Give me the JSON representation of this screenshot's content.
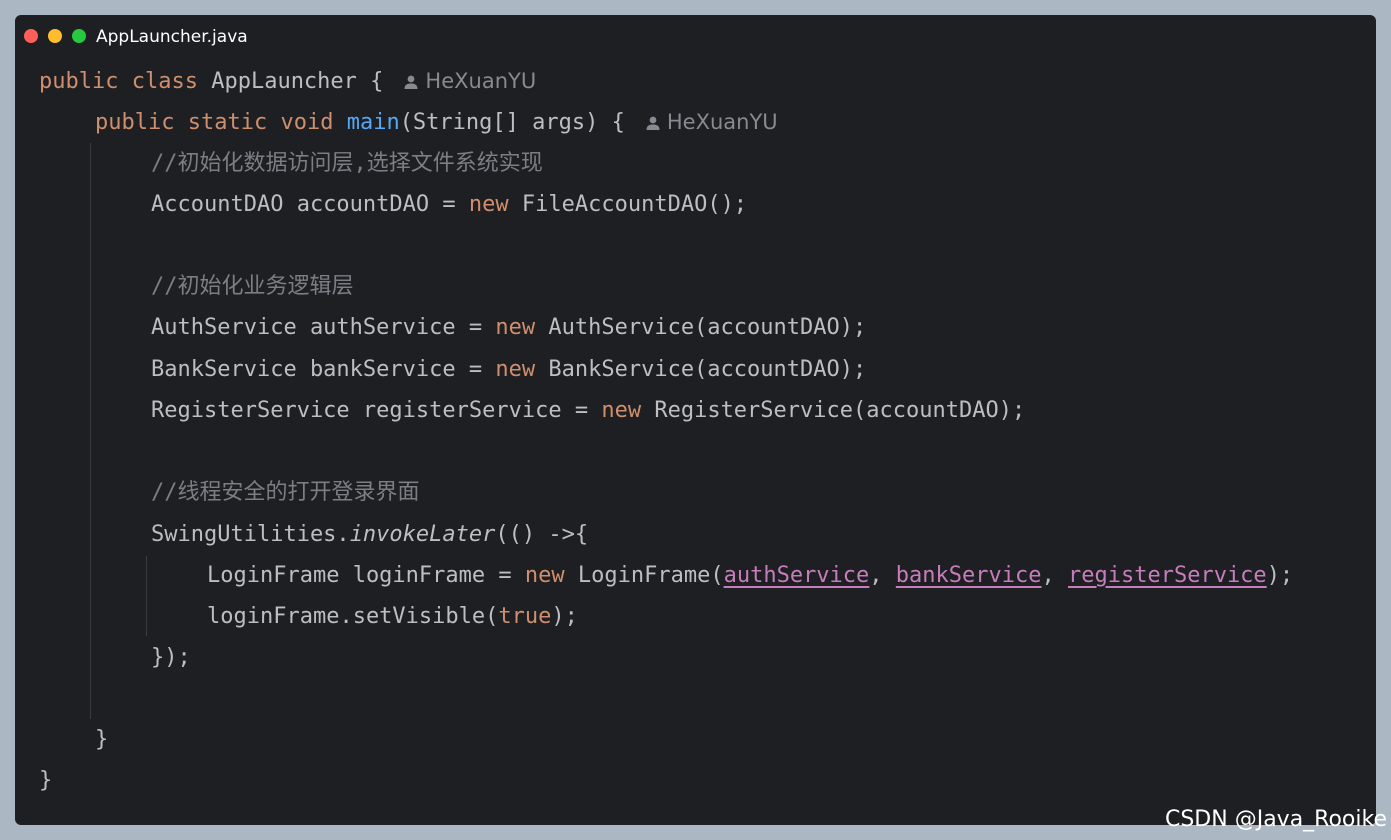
{
  "window": {
    "filename": "AppLauncher.java"
  },
  "authors": {
    "class_author": "HeXuanYU",
    "method_author": "HeXuanYU"
  },
  "code": {
    "l1": {
      "kw1": "public",
      "kw2": "class",
      "name": "AppLauncher",
      "brace": "{"
    },
    "l2": {
      "kw1": "public",
      "kw2": "static",
      "kw3": "void",
      "fn": "main",
      "rest": "(String[] args) {"
    },
    "l3": {
      "comment": "//初始化数据访问层,选择文件系统实现"
    },
    "l4": {
      "pre": "AccountDAO accountDAO = ",
      "kw": "new",
      "post": " FileAccountDAO();"
    },
    "l6": {
      "comment": "//初始化业务逻辑层"
    },
    "l7": {
      "pre": "AuthService authService = ",
      "kw": "new",
      "post": " AuthService(accountDAO);"
    },
    "l8": {
      "pre": "BankService bankService = ",
      "kw": "new",
      "post": " BankService(accountDAO);"
    },
    "l9": {
      "pre": "RegisterService registerService = ",
      "kw": "new",
      "post": " RegisterService(accountDAO);"
    },
    "l11": {
      "comment": "//线程安全的打开登录界面"
    },
    "l12": {
      "pre": "SwingUtilities.",
      "method": "invokeLater",
      "post": "(() ->{"
    },
    "l13": {
      "pre": "LoginFrame loginFrame = ",
      "kw": "new",
      "mid": " LoginFrame(",
      "arg1": "authService",
      "sep1": ", ",
      "arg2": "bankService",
      "sep2": ", ",
      "arg3": "registerService",
      "post": ");"
    },
    "l14": {
      "pre": "loginFrame.setVisible(",
      "kw": "true",
      "post": ");"
    },
    "l15": {
      "text": "});"
    },
    "l17": {
      "text": "}"
    },
    "l18": {
      "text": "}"
    }
  },
  "watermark": "CSDN @Java_Rooike",
  "colors": {
    "background": "#1e1f22",
    "keyword": "#cf8e6d",
    "function": "#56a8f5",
    "comment": "#7a7e85",
    "parameter": "#c77dbb",
    "text": "#bcbec4"
  },
  "icons": {
    "author_icon": "person-icon"
  }
}
